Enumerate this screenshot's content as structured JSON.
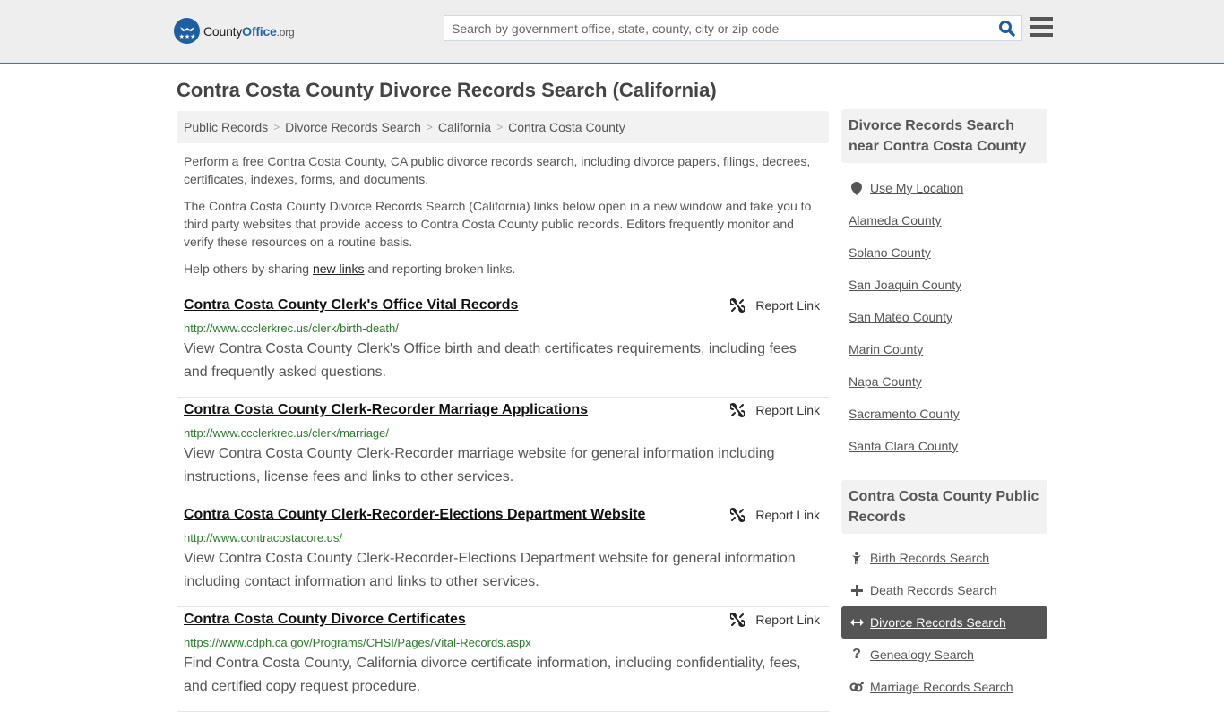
{
  "header": {
    "logo": {
      "county": "County",
      "office": "Office",
      "org": ".org"
    },
    "search": {
      "placeholder": "Search by government office, state, county, city or zip code",
      "value": ""
    },
    "search_icon": "search-icon",
    "menu_icon": "hamburger-menu-icon"
  },
  "page": {
    "title": "Contra Costa County Divorce Records Search (California)",
    "breadcrumb": [
      "Public Records",
      "Divorce Records Search",
      "California",
      "Contra Costa County"
    ],
    "intro1": "Perform a free Contra Costa County, CA public divorce records search, including divorce papers, filings, decrees, certificates, indexes, forms, and documents.",
    "intro2": "The Contra Costa County Divorce Records Search (California) links below open in a new window and take you to third party websites that provide access to Contra Costa County public records. Editors frequently monitor and verify these resources on a routine basis.",
    "intro3_before": "Help others by sharing ",
    "intro3_link": "new links",
    "intro3_after": " and reporting broken links."
  },
  "results": [
    {
      "title": "Contra Costa County Clerk's Office Vital Records",
      "url": "http://www.ccclerkrec.us/clerk/birth-death/",
      "description": "View Contra Costa County Clerk's Office birth and death certificates requirements, including fees and frequently asked questions.",
      "report_label": "Report Link"
    },
    {
      "title": "Contra Costa County Clerk-Recorder Marriage Applications",
      "url": "http://www.ccclerkrec.us/clerk/marriage/",
      "description": "View Contra Costa County Clerk-Recorder marriage website for general information including instructions, license fees and links to other services.",
      "report_label": "Report Link"
    },
    {
      "title": "Contra Costa County Clerk-Recorder-Elections Department Website",
      "url": "http://www.contracostacore.us/",
      "description": "View Contra Costa County Clerk-Recorder-Elections Department website for general information including contact information and links to other services.",
      "report_label": "Report Link"
    },
    {
      "title": "Contra Costa County Divorce Certificates",
      "url": "https://www.cdph.ca.gov/Programs/CHSI/Pages/Vital-Records.aspx",
      "description": "Find Contra Costa County, California divorce certificate information, including confidentiality, fees, and certified copy request procedure.",
      "report_label": "Report Link"
    }
  ],
  "sidebar": {
    "nearby_heading": "Divorce Records Search near Contra Costa County",
    "use_location": "Use My Location",
    "nearby": [
      "Alameda County",
      "Solano County",
      "San Joaquin County",
      "San Mateo County",
      "Marin County",
      "Napa County",
      "Sacramento County",
      "Santa Clara County"
    ],
    "public_heading": "Contra Costa County Public Records",
    "public_records": [
      {
        "label": "Birth Records Search",
        "icon": "child-icon",
        "active": false
      },
      {
        "label": "Death Records Search",
        "icon": "plus-icon",
        "active": false
      },
      {
        "label": "Divorce Records Search",
        "icon": "arrows-horizontal-icon",
        "active": true
      },
      {
        "label": "Genealogy Search",
        "icon": "question-icon",
        "active": false
      },
      {
        "label": "Marriage Records Search",
        "icon": "gender-icon",
        "active": false
      }
    ]
  },
  "colors": {
    "brand_blue": "#1d5fa3",
    "header_bg": "#eeeeee",
    "url_green": "#2a7a2a",
    "active_item_bg": "#555555"
  }
}
